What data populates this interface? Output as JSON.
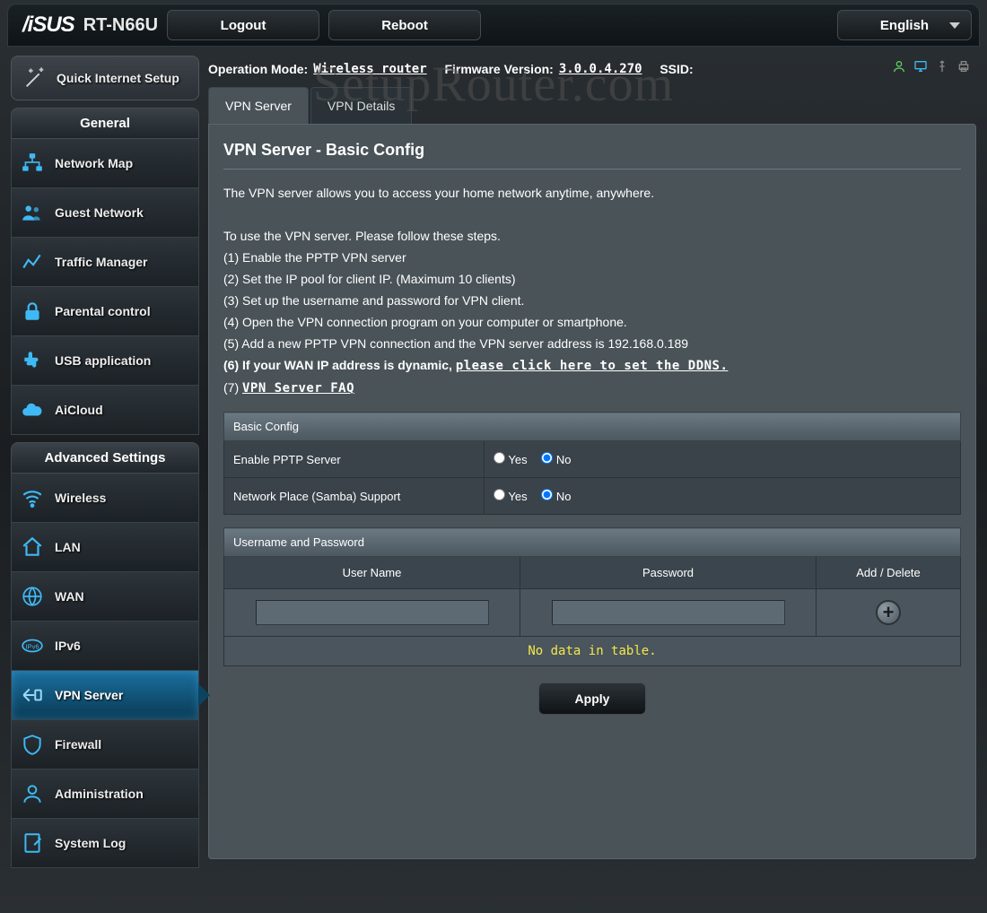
{
  "brand": "/SUS",
  "model": "RT-N66U",
  "header": {
    "logout": "Logout",
    "reboot": "Reboot",
    "language": "English"
  },
  "info": {
    "op_mode_label": "Operation Mode:",
    "op_mode_value": "Wireless router",
    "fw_label": "Firmware Version:",
    "fw_value": "3.0.0.4.270",
    "ssid_label": "SSID:"
  },
  "qis": "Quick Internet Setup",
  "section_general": "General",
  "menu_general": [
    "Network Map",
    "Guest Network",
    "Traffic Manager",
    "Parental control",
    "USB application",
    "AiCloud"
  ],
  "section_advanced": "Advanced Settings",
  "menu_advanced": [
    "Wireless",
    "LAN",
    "WAN",
    "IPv6",
    "VPN Server",
    "Firewall",
    "Administration",
    "System Log"
  ],
  "tabs": {
    "server": "VPN Server",
    "details": "VPN Details"
  },
  "page": {
    "title": "VPN Server - Basic Config",
    "intro": "The VPN server allows you to access your home network anytime, anywhere.",
    "steps_lead": "To use the VPN server. Please follow these steps.",
    "s1": "(1) Enable the PPTP VPN server",
    "s2": "(2) Set the IP pool for client IP. (Maximum 10 clients)",
    "s3": "(3) Set up the username and password for VPN client.",
    "s4": "(4) Open the VPN connection program on your computer or smartphone.",
    "s5": "(5) Add a new PPTP VPN connection and the VPN server address is 192.168.0.189",
    "s6a": "(6) If your WAN IP address is dynamic, ",
    "s6b": "please click here to set the DDNS.",
    "s7a": "(7) ",
    "s7b": "VPN Server FAQ",
    "cfg_header": "Basic Config",
    "row1": "Enable PPTP Server",
    "row2": "Network Place (Samba) Support",
    "yes": "Yes",
    "no": "No",
    "user_header": "Username and Password",
    "col_user": "User Name",
    "col_pass": "Password",
    "col_action": "Add / Delete",
    "no_data": "No data in table.",
    "apply": "Apply"
  },
  "watermark": "SetupRouter.com"
}
